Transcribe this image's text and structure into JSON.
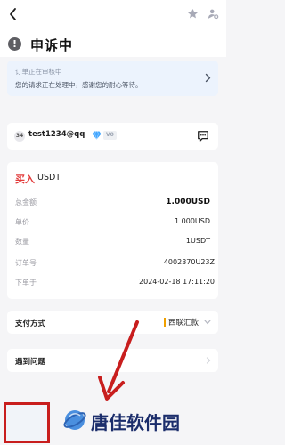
{
  "top_bar": {
    "back_icon": "chevron-left-icon",
    "favorite_icon": "star-icon",
    "settings_icon": "user-settings-icon"
  },
  "status": {
    "icon_glyph": "!",
    "title": "申诉中"
  },
  "notice": {
    "title": "订单正在审核中",
    "text": "您的请求正在处理中，感谢您的耐心等待。",
    "icon": "chevron-right-icon"
  },
  "counterparty": {
    "avatar_text": "34",
    "username": "test1234@qq",
    "badge_icon": "diamond-icon",
    "vip_label": "V0",
    "chat_icon": "chat-icon"
  },
  "order": {
    "side": "买入",
    "asset": "USDT",
    "rows": [
      {
        "label": "总金额",
        "value": "1.000USD"
      },
      {
        "label": "单价",
        "value": "1.000USD"
      },
      {
        "label": "数量",
        "value": "1USDT"
      },
      {
        "label": "订单号",
        "value": "4002370U23Z"
      },
      {
        "label": "下单于",
        "value": "2024-02-18 17:11:20"
      }
    ]
  },
  "payment": {
    "label": "支付方式",
    "value": "西联汇款",
    "accent_color": "#f0a000",
    "icon": "chevron-down-icon"
  },
  "issue": {
    "label": "遇到问题",
    "icon": "chevron-right-icon"
  },
  "watermark": {
    "text": "唐佳软件园",
    "highlight_color": "#c81e1e"
  }
}
